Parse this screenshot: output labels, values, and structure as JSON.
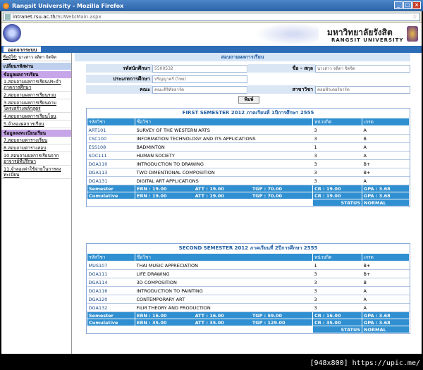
{
  "window": {
    "title": "Rangsit University - Mozilla Firefox",
    "min": "_",
    "max": "□",
    "close": "×"
  },
  "url": {
    "domain": "intranet.rsu.ac.th",
    "path": "/SUWeb/Main.aspx",
    "bookmark": "☆"
  },
  "header": {
    "uni_th": "มหาวิทยาลัยรังสิต",
    "uni_en": "RANGSIT UNIVERSITY"
  },
  "nav": {
    "logout": "ออกจากระบบ"
  },
  "sidebar": {
    "user_label": "ชื่อผู้ใช้:",
    "user_name": "นางสาว จลิดา จิตจิต",
    "change_password": "เปลี่ยนรหัสผ่าน",
    "section1": "ข้อมูลผลการเรียน",
    "items1": [
      "1.สอบถามผลการเรียนประจำภาคการศึกษา",
      "2.สอบถามผลการเรียนรวม",
      "3.สอบถามผลการเรียนตามโครงสร้างหลักสูตร",
      "4.สอบถามผลการเรียนโอน",
      "5.จำลองผลการเรียน"
    ],
    "section2": "ข้อมูลลงทะเบียนเรียน",
    "items2": [
      "7.สอบถามตารางเรียน",
      "8.สอบถามตารางสอบ",
      "10.สอบถามผลการเรียนจากอาจารย์ที่ปรึกษา",
      "11.จำลองค่าใช้จ่ายในการลงทะเบียน"
    ]
  },
  "main": {
    "title": "สอบถามผลการเรียน",
    "student_id_label": "รหัสนักศึกษา",
    "student_id": "5500532",
    "name_label": "ชื่อ - สกุล",
    "name_value": "นางสาว จลิดา จิตจิต",
    "type_label": "ประเภทการศึกษา",
    "type_value": "ปริญญาตรี (ไทย)",
    "faculty_label": "คณะ",
    "faculty_value": "คณะดิจิทัลอาร์ต",
    "major_label": "สาขาวิชา",
    "major_value": "คอมพิวเตอร์อาร์ต",
    "print_label": "พิมพ์"
  },
  "columns": {
    "code": "รหัสวิชา",
    "name": "ชื่อวิชา",
    "unit": "หน่วยกิต",
    "grade": "เกรด"
  },
  "semesters": [
    {
      "title": "FIRST SEMESTER 2012 ภาคเรียนที่ 1ปีการศึกษา 2555",
      "courses": [
        {
          "code": "ART101",
          "name": "SURVEY OF THE WESTERN ARTS",
          "unit": "3",
          "grade": "A"
        },
        {
          "code": "CSC100",
          "name": "INFORMATION TECHNOLOGY AND ITS APPLICATIONS",
          "unit": "3",
          "grade": "B"
        },
        {
          "code": "ESS108",
          "name": "BADMINTON",
          "unit": "1",
          "grade": "A"
        },
        {
          "code": "SOC111",
          "name": "HUMAN SOCIETY",
          "unit": "3",
          "grade": "A"
        },
        {
          "code": "DGA110",
          "name": "INTRODUCTION TO DRAWING",
          "unit": "3",
          "grade": "B+"
        },
        {
          "code": "DGA113",
          "name": "TWO DIMENTIONAL COMPOSITION",
          "unit": "3",
          "grade": "B+"
        },
        {
          "code": "DGA131",
          "name": "DIGITAL ART APPLICATIONS",
          "unit": "3",
          "grade": "A"
        }
      ],
      "semester": {
        "label": "Semester",
        "ern": "ERN : 19.00",
        "att": "ATT : 19.00",
        "tgp": "TGP : 70.00",
        "cr": "CR : 19.00",
        "gpa": "GPA : 3.68"
      },
      "cumulative": {
        "label": "Cumulative",
        "ern": "ERN : 19.00",
        "att": "ATT : 19.00",
        "tgp": "TGP : 70.00",
        "cr": "CR : 19.00",
        "gpa": "GPA : 3.68"
      },
      "status_label": "STATUS",
      "status_value": "NORMAL"
    },
    {
      "title": "SECOND SEMESTER 2012 ภาคเรียนที่ 2ปีการศึกษา 2555",
      "courses": [
        {
          "code": "MUS107",
          "name": "THAI MUSIC APPRECIATION",
          "unit": "1",
          "grade": "B+"
        },
        {
          "code": "DGA111",
          "name": "LIFE DRAWING",
          "unit": "3",
          "grade": "B+"
        },
        {
          "code": "DGA114",
          "name": "3D COMPOSITION",
          "unit": "3",
          "grade": "B"
        },
        {
          "code": "DGA116",
          "name": "INTRODUCTION TO PAINTING",
          "unit": "3",
          "grade": "A"
        },
        {
          "code": "DGA120",
          "name": "CONTEMPORARY ART",
          "unit": "3",
          "grade": "A"
        },
        {
          "code": "DGA132",
          "name": "FILM THEORY AND PRODUCTION",
          "unit": "3",
          "grade": "A"
        }
      ],
      "semester": {
        "label": "Semester",
        "ern": "ERN : 16.00",
        "att": "ATT : 16.00",
        "tgp": "TGP : 59.00",
        "cr": "CR : 16.00",
        "gpa": "GPA : 3.68"
      },
      "cumulative": {
        "label": "Cumulative",
        "ern": "ERN : 35.00",
        "att": "ATT : 35.00",
        "tgp": "TGP : 129.00",
        "cr": "CR : 35.00",
        "gpa": "GPA : 3.68"
      },
      "status_label": "STATUS",
      "status_value": "NORMAL"
    }
  ],
  "watermark": "[948x800] https://upic.me/"
}
